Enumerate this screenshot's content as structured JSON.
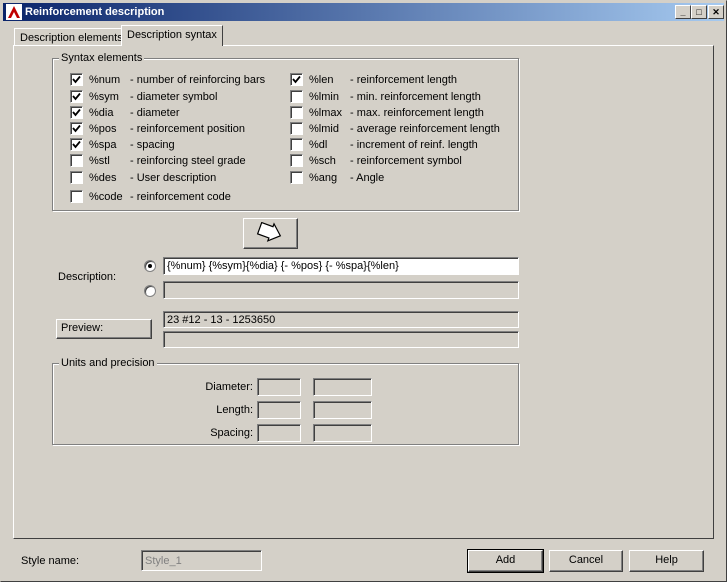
{
  "window": {
    "title": "Reinforcement description"
  },
  "tabs": [
    {
      "label": "Description elements",
      "active": false
    },
    {
      "label": "Description syntax",
      "active": true
    }
  ],
  "syntax_elements": {
    "title": "Syntax elements",
    "left": [
      {
        "code": "%num",
        "desc": "- number of reinforcing bars",
        "checked": true
      },
      {
        "code": "%sym",
        "desc": "- diameter symbol",
        "checked": true
      },
      {
        "code": "%dia",
        "desc": "- diameter",
        "checked": true
      },
      {
        "code": "%pos",
        "desc": "- reinforcement position",
        "checked": true
      },
      {
        "code": "%spa",
        "desc": "- spacing",
        "checked": true
      },
      {
        "code": "%stl",
        "desc": "- reinforcing steel grade",
        "checked": false
      },
      {
        "code": "%des",
        "desc": "- User description",
        "checked": false
      },
      {
        "code": "%code",
        "desc": "- reinforcement code",
        "checked": false
      }
    ],
    "right": [
      {
        "code": "%len",
        "desc": "- reinforcement length",
        "checked": true
      },
      {
        "code": "%lmin",
        "desc": "- min. reinforcement length",
        "checked": false
      },
      {
        "code": "%lmax",
        "desc": "- max. reinforcement length",
        "checked": false
      },
      {
        "code": "%lmid",
        "desc": "- average reinforcement length",
        "checked": false
      },
      {
        "code": "%dl",
        "desc": "- increment of reinf. length",
        "checked": false
      },
      {
        "code": "%sch",
        "desc": "- reinforcement symbol",
        "checked": false
      },
      {
        "code": "%ang",
        "desc": "- Angle",
        "checked": false
      }
    ]
  },
  "insert_button": {
    "icon": "insert-arrow-icon"
  },
  "description": {
    "label": "Description:",
    "line1": "{%num} {%sym}{%dia} {- %pos} {- %spa}{%len}",
    "line2": "",
    "selected_line": 1
  },
  "preview": {
    "button_label": "Preview:",
    "line1": "23 #12 - 13 - 1253650",
    "line2": ""
  },
  "units": {
    "title": "Units and precision",
    "rows": [
      {
        "label": "Diameter:",
        "unit": "",
        "precision": ""
      },
      {
        "label": "Length:",
        "unit": "",
        "precision": ""
      },
      {
        "label": "Spacing:",
        "unit": "",
        "precision": ""
      }
    ]
  },
  "footer": {
    "style_name_label": "Style name:",
    "style_name_value": "Style_1",
    "add_label": "Add",
    "cancel_label": "Cancel",
    "help_label": "Help"
  }
}
